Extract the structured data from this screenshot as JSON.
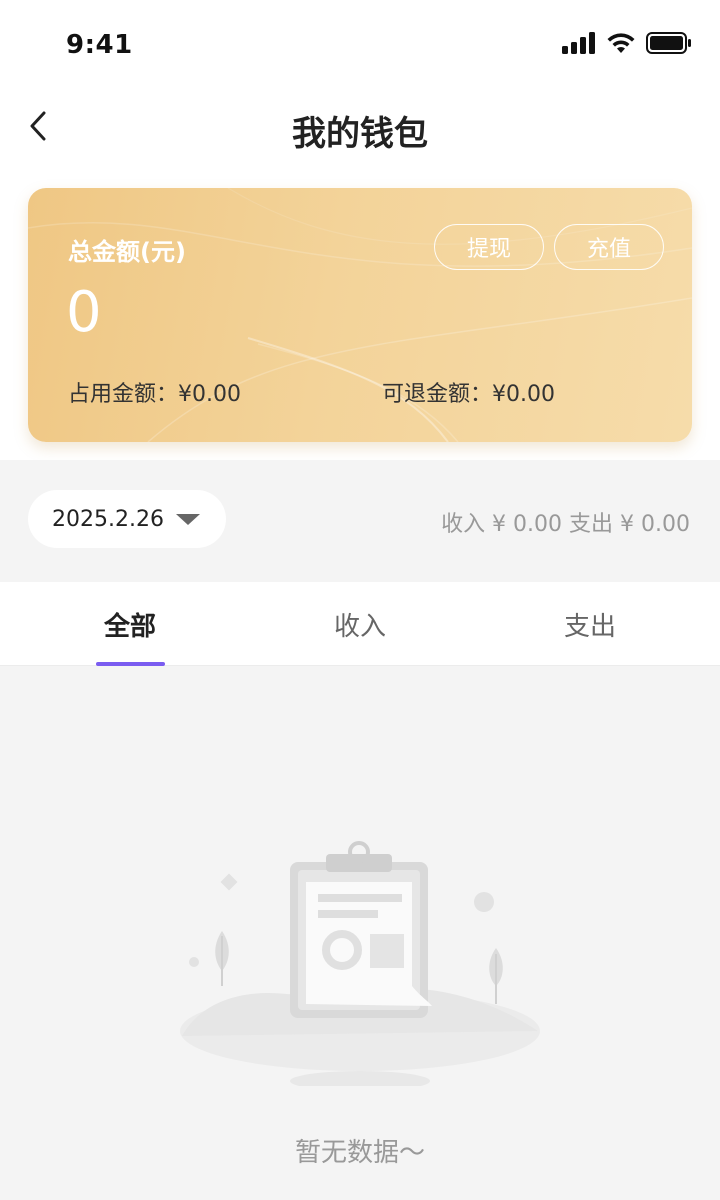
{
  "status_bar": {
    "time": "9:41",
    "icons": [
      "signal-icon",
      "wifi-icon",
      "battery-icon"
    ]
  },
  "nav": {
    "back_icon": "chevron-left-icon",
    "title": "我的钱包"
  },
  "wallet_card": {
    "total_label": "总金额(元)",
    "total_value": "0",
    "withdraw_label": "提现",
    "recharge_label": "充值",
    "occupied_text": "占用金额：¥0.00",
    "refundable_text": "可退金额：¥0.00",
    "gradient_start": "#efc784",
    "gradient_end": "#f6dcaa"
  },
  "filter": {
    "date": "2025.2.26",
    "summary": "收入 ¥ 0.00  支出 ¥ 0.00"
  },
  "tabs": {
    "items": [
      {
        "label": "全部",
        "active": true
      },
      {
        "label": "收入",
        "active": false
      },
      {
        "label": "支出",
        "active": false
      }
    ],
    "indicator_color": "#7a5cf0"
  },
  "empty_state": {
    "icon": "empty-clipboard-icon",
    "text": "暂无数据～"
  }
}
